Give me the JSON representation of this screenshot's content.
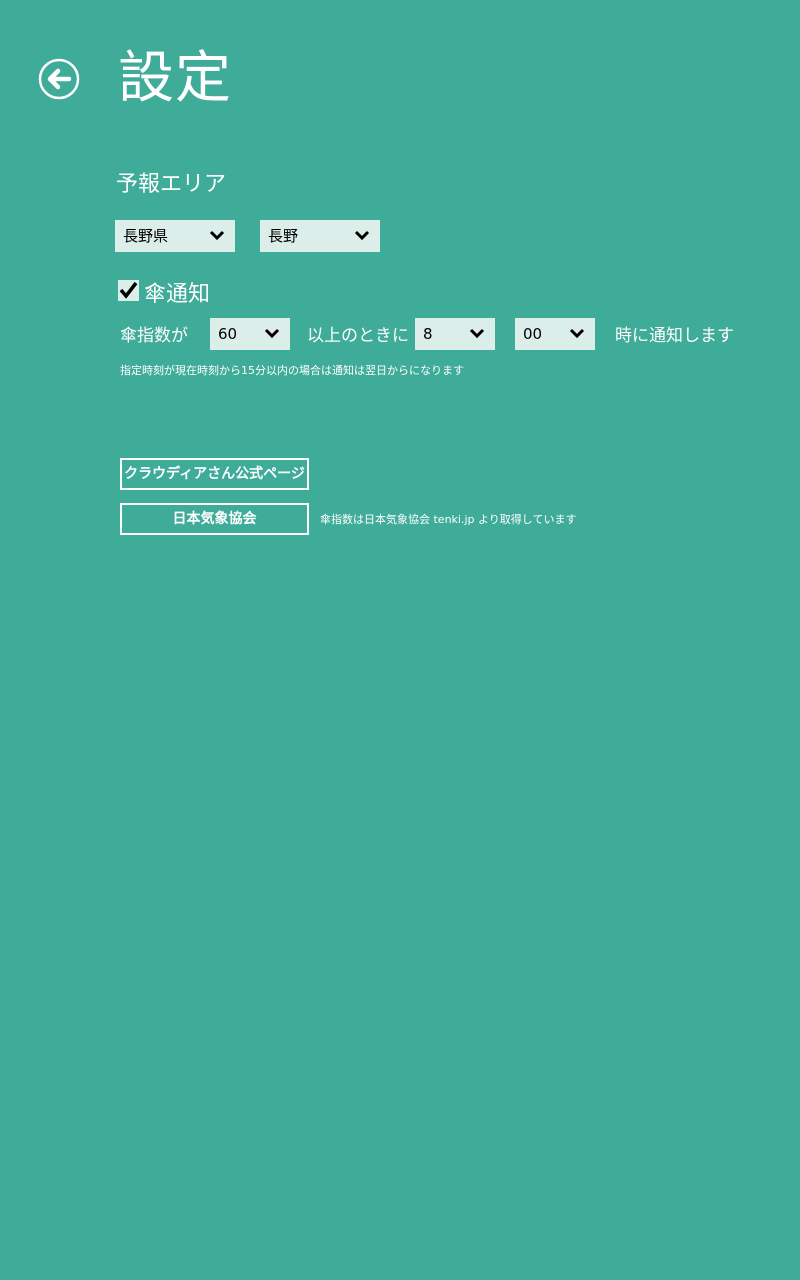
{
  "header": {
    "title": "設定",
    "back_icon": "back-arrow-circle-icon"
  },
  "forecast_area": {
    "label": "予報エリア",
    "prefecture_select": {
      "value": "長野県",
      "icon": "chevron-down-icon"
    },
    "city_select": {
      "value": "長野",
      "icon": "chevron-down-icon"
    }
  },
  "umbrella_notification": {
    "checked": true,
    "label": "傘通知",
    "index_prefix": "傘指数が",
    "index_select_value": "60",
    "threshold_text": "以上のときに",
    "hour_select_value": "8",
    "minute_select_value": "00",
    "suffix_text": "時に通知します",
    "note": "指定時刻が現在時刻から15分以内の場合は通知は翌日からになります"
  },
  "links": {
    "claudia_button": "クラウディアさん公式ページ",
    "jwa_button": "日本気象協会",
    "source_note": "傘指数は日本気象協会 tenki.jp より取得しています"
  },
  "colors": {
    "background": "#3fab99",
    "select_background": "#dbeee9",
    "text": "#ffffff"
  }
}
